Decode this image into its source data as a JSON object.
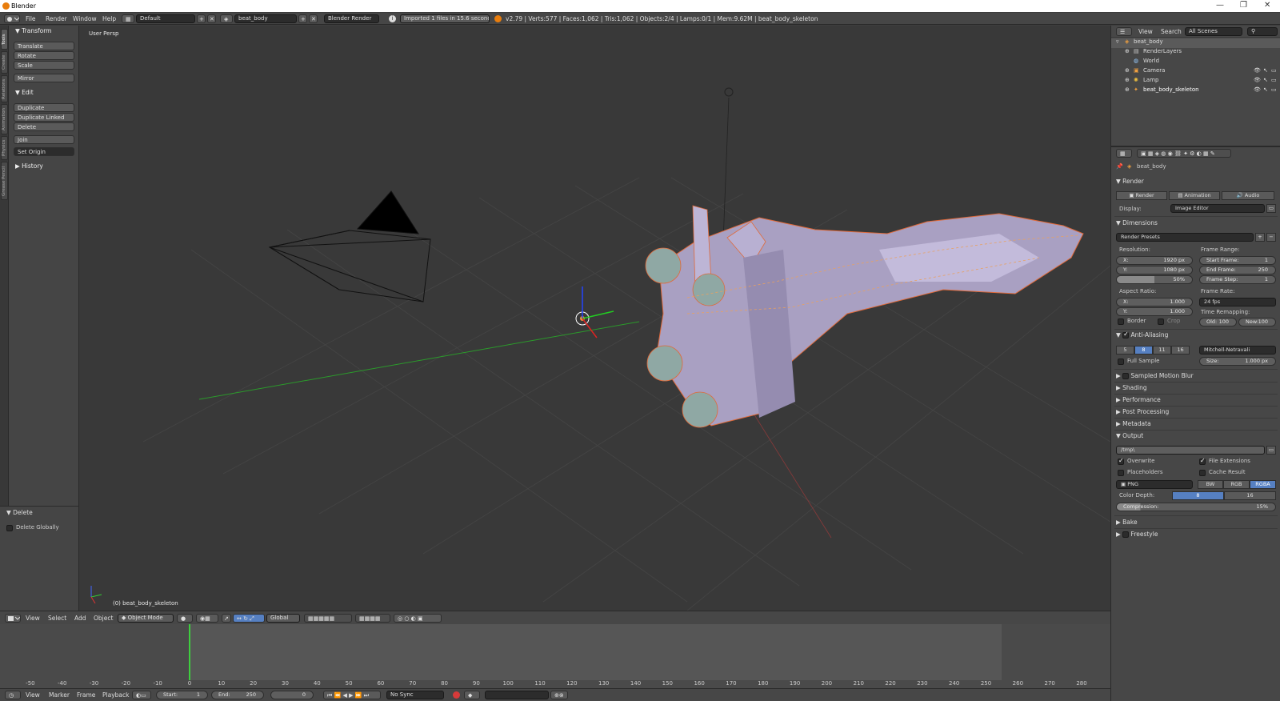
{
  "window": {
    "title": "Blender",
    "controls": [
      "—",
      "❐",
      "✕"
    ]
  },
  "info_header": {
    "menus": [
      "File",
      "Render",
      "Window",
      "Help"
    ],
    "screen_layout": "Default",
    "scene": "beat_body",
    "engine": "Blender Render",
    "report": "Imported 1 files in 15.6 seconds",
    "stats": "v2.79 | Verts:577 | Faces:1,062 | Tris:1,062 | Objects:2/4 | Lamps:0/1 | Mem:9.62M | beat_body_skeleton"
  },
  "left_tabs": [
    "Tools",
    "Create",
    "Relations",
    "Animation",
    "Physics",
    "Grease Pencil"
  ],
  "toolshelf": {
    "transform_header": "Transform",
    "transform_buttons": [
      "Translate",
      "Rotate",
      "Scale"
    ],
    "mirror": "Mirror",
    "edit_header": "Edit",
    "edit_buttons": [
      "Duplicate",
      "Duplicate Linked",
      "Delete"
    ],
    "join": "Join",
    "set_origin": "Set Origin",
    "history_header": "History"
  },
  "last_operator": {
    "header": "Delete",
    "option": "Delete Globally"
  },
  "viewport": {
    "view_label": "User Persp",
    "object_label": "(0) beat_body_skeleton"
  },
  "viewport_header": {
    "menus": [
      "View",
      "Select",
      "Add",
      "Object"
    ],
    "mode": "Object Mode",
    "orientation": "Global"
  },
  "timeline": {
    "ticks": [
      "-50",
      "-40",
      "-30",
      "-20",
      "-10",
      "0",
      "10",
      "20",
      "30",
      "40",
      "50",
      "60",
      "70",
      "80",
      "90",
      "100",
      "110",
      "120",
      "130",
      "140",
      "150",
      "160",
      "170",
      "180",
      "190",
      "200",
      "210",
      "220",
      "230",
      "240",
      "250",
      "260",
      "270",
      "280"
    ],
    "menus": [
      "View",
      "Marker",
      "Frame",
      "Playback"
    ],
    "start_label": "Start:",
    "start": "1",
    "end_label": "End:",
    "end": "250",
    "current": "0",
    "sync": "No Sync"
  },
  "outliner": {
    "menus": [
      "View",
      "Search"
    ],
    "scenes": "All Scenes",
    "items": [
      {
        "name": "beat_body",
        "indent": 0
      },
      {
        "name": "RenderLayers",
        "indent": 1
      },
      {
        "name": "World",
        "indent": 1
      },
      {
        "name": "Camera",
        "indent": 1
      },
      {
        "name": "Lamp",
        "indent": 1
      },
      {
        "name": "beat_body_skeleton",
        "indent": 1
      }
    ]
  },
  "properties": {
    "context": "beat_body",
    "render_header": "Render",
    "render_btn": "Render",
    "animation_btn": "Animation",
    "audio_btn": "Audio",
    "display_label": "Display:",
    "display_value": "Image Editor",
    "dimensions_header": "Dimensions",
    "render_presets": "Render Presets",
    "resolution_label": "Resolution:",
    "res_x": "1920 px",
    "res_y": "1080 px",
    "res_pct": "50%",
    "aspect_label": "Aspect Ratio:",
    "asp_x": "1.000",
    "asp_y": "1.000",
    "border": "Border",
    "crop": "Crop",
    "frame_range_label": "Frame Range:",
    "start_frame_label": "Start Frame:",
    "start_frame": "1",
    "end_frame_label": "End Frame:",
    "end_frame": "250",
    "frame_step_label": "Frame Step:",
    "frame_step": "1",
    "frame_rate_label": "Frame Rate:",
    "frame_rate": "24 fps",
    "time_remap_label": "Time Remapping:",
    "old_label": "Old:",
    "old": "100",
    "new_label": "New:",
    "new": "100",
    "x_label": "X:",
    "y_label": "Y:",
    "aa_header": "Anti-Aliasing",
    "aa_samples": [
      "5",
      "8",
      "11",
      "16"
    ],
    "aa_filter": "Mitchell-Netravali",
    "full_sample": "Full Sample",
    "size_label": "Size:",
    "size": "1.000 px",
    "collapsed_sections": [
      "Sampled Motion Blur",
      "Shading",
      "Performance",
      "Post Processing",
      "Metadata"
    ],
    "output_header": "Output",
    "output_path": "/tmp\\",
    "overwrite": "Overwrite",
    "file_extensions": "File Extensions",
    "placeholders": "Placeholders",
    "cache_result": "Cache Result",
    "file_format": "PNG",
    "color_modes": [
      "BW",
      "RGB",
      "RGBA"
    ],
    "color_depth_label": "Color Depth:",
    "depths": [
      "8",
      "16"
    ],
    "compression_label": "Compression:",
    "compression": "15%",
    "bake_header": "Bake",
    "freestyle_header": "Freestyle"
  }
}
